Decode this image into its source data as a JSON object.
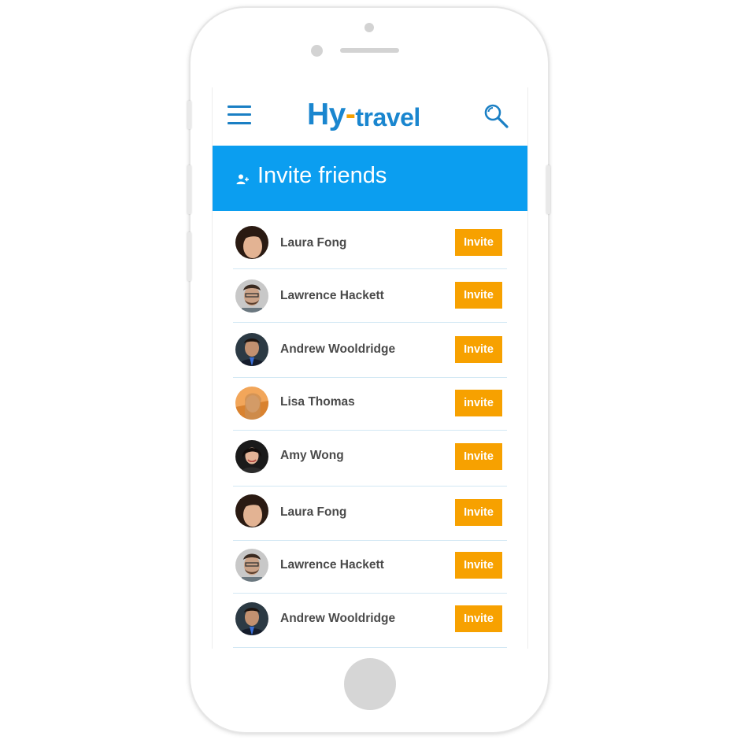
{
  "app": {
    "logo_hy": "Hy",
    "logo_dash": "-",
    "logo_travel": "travel",
    "brand_blue": "#1a86cf",
    "brand_orange": "#f5a000"
  },
  "header": {
    "menu_icon": "hamburger-menu-icon",
    "search_icon": "search-icon"
  },
  "title_bar": {
    "icon": "person-add-icon",
    "title": "Invite friends",
    "background": "#0b9ef0"
  },
  "friends": [
    {
      "name": "Laura Fong",
      "button_label": "Invite"
    },
    {
      "name": "Lawrence Hackett",
      "button_label": "Invite"
    },
    {
      "name": "Andrew Wooldridge",
      "button_label": "Invite"
    },
    {
      "name": "Lisa Thomas",
      "button_label": "invite"
    },
    {
      "name": "Amy Wong",
      "button_label": "Invite"
    },
    {
      "name": "Laura Fong",
      "button_label": "Invite"
    },
    {
      "name": "Lawrence Hackett",
      "button_label": "Invite"
    },
    {
      "name": "Andrew Wooldridge",
      "button_label": "Invite"
    }
  ],
  "invite_button_color": "#f7a100"
}
